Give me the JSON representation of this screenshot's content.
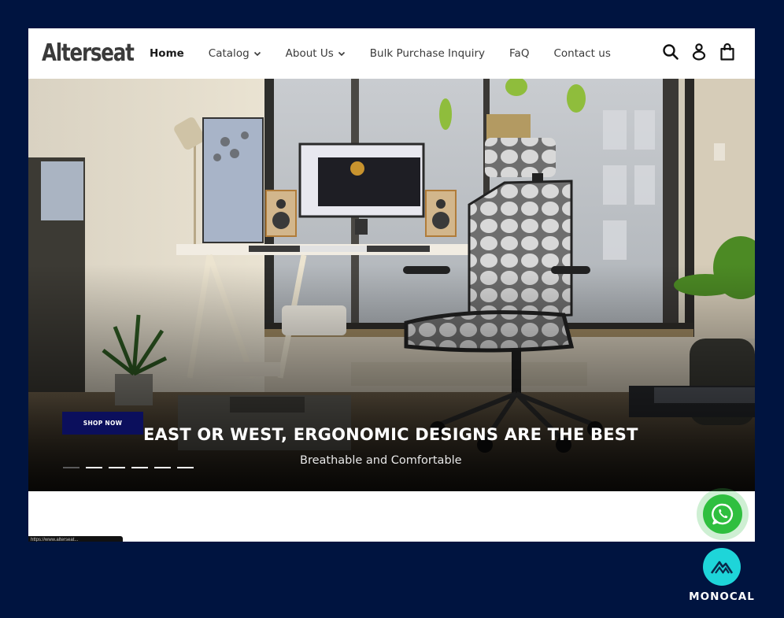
{
  "header": {
    "logo": "Alterseat",
    "nav": [
      {
        "label": "Home",
        "active": true,
        "dropdown": false
      },
      {
        "label": "Catalog",
        "active": false,
        "dropdown": true
      },
      {
        "label": "About Us",
        "active": false,
        "dropdown": true
      },
      {
        "label": "Bulk Purchase Inquiry",
        "active": false,
        "dropdown": false
      },
      {
        "label": "FaQ",
        "active": false,
        "dropdown": false
      },
      {
        "label": "Contact us",
        "active": false,
        "dropdown": false
      }
    ],
    "icons": [
      "search-icon",
      "account-icon",
      "cart-icon"
    ]
  },
  "hero": {
    "button_label": "SHOP NOW",
    "headline": "EAST OR WEST, ERGONOMIC DESIGNS ARE THE BEST",
    "subheadline": "Breathable and Comfortable",
    "slides_total": 6,
    "active_slide": 1
  },
  "status_bar": {
    "url_fragment": "https://www.alterseat..."
  },
  "floating": {
    "whatsapp_icon": "whatsapp-icon"
  },
  "watermark": {
    "brand": "MONOCAL"
  },
  "colors": {
    "page_background": "#001440",
    "shop_button": "#0b0f5c",
    "whatsapp": "#2fbf3f",
    "monocal": "#1ed5d9"
  }
}
